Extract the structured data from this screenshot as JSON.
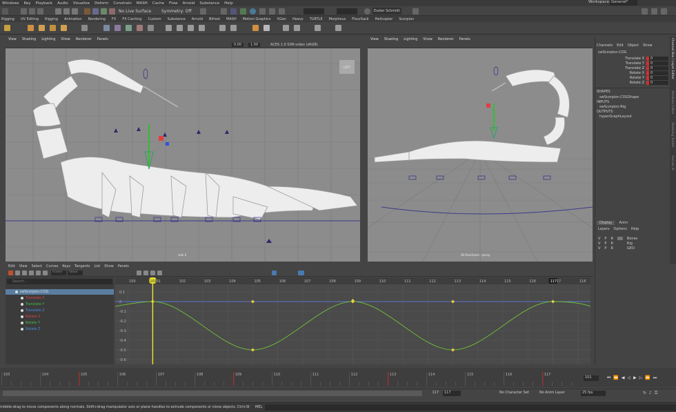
{
  "menu": [
    "Windows",
    "Key",
    "Playback",
    "Audio",
    "Visualize",
    "Deform",
    "Constrain",
    "MASH",
    "Cache",
    "Flow",
    "Arnold",
    "Substance",
    "Help"
  ],
  "toolbar": {
    "live_surface": "No Live Surface",
    "symmetry": "Symmetry: Off",
    "user": "Eszter Schmidt",
    "workspace_label": "Workspace:",
    "workspace": "General*"
  },
  "shelf_tabs": [
    "Rigging",
    "UV Editing",
    "Rigging",
    "Animation",
    "Rendering",
    "FX",
    "FX Caching",
    "Custom",
    "Substance",
    "Arnold",
    "Bifrost",
    "MASH",
    "Motion Graphics",
    "XGen",
    "Heavy",
    "TURTLE",
    "Morpheus",
    "FlourSack",
    "Helicopter",
    "Scorpion"
  ],
  "viewport_menu": [
    "View",
    "Shading",
    "Lighting",
    "Show",
    "Renderer",
    "Panels"
  ],
  "viewport_left": {
    "value_a": "0.00",
    "value_b": "1.00",
    "colorspace": "ACES 1.0 SDR-video (sRGB)",
    "camera_tag": "LEFT",
    "label": "side X"
  },
  "viewport_right": {
    "label": "2D Pan/Zoom : persp"
  },
  "channel_box": {
    "tabs": [
      "Channels",
      "Edit",
      "Object",
      "Show"
    ],
    "object": "swScorpion:COG",
    "attrs": [
      {
        "name": "Translate X",
        "value": "0"
      },
      {
        "name": "Translate Y",
        "value": "0"
      },
      {
        "name": "Translate Z",
        "value": "0"
      },
      {
        "name": "Rotate X",
        "value": "0"
      },
      {
        "name": "Rotate Y",
        "value": "0"
      },
      {
        "name": "Rotate Z",
        "value": "0"
      }
    ],
    "shapes_header": "SHAPES",
    "shape": "swScorpion:COGShape",
    "inputs_header": "INPUTS",
    "input": "swScorpion:Rig",
    "outputs_header": "OUTPUTS",
    "output": "hyperGraphLayout"
  },
  "side_tabs": [
    "Channel Box / Layer Editor",
    "Attribute Editor",
    "Modeling Toolkit",
    "Human IK"
  ],
  "layer_editor": {
    "tabs": [
      "Display",
      "Anim"
    ],
    "menu": [
      "Layers",
      "Options",
      "Help"
    ],
    "layers": [
      {
        "v": "V",
        "p": "P",
        "r": "R",
        "name": "Bones"
      },
      {
        "v": "V",
        "p": "P",
        "r": "R",
        "name": "Rig"
      },
      {
        "v": "V",
        "p": "P",
        "r": "R",
        "name": "GEO"
      }
    ]
  },
  "graph_editor": {
    "menu": [
      "Edit",
      "View",
      "Select",
      "Curves",
      "Keys",
      "Tangents",
      "List",
      "Show",
      "Panels"
    ],
    "stats_a": "Frame",
    "stats_b": "Value",
    "search_placeholder": "Search...",
    "outliner": [
      {
        "name": "swScorpion:COG",
        "color": "#dddddd"
      },
      {
        "name": "Translate X",
        "color": "#e04040"
      },
      {
        "name": "Translate Y",
        "color": "#40c040"
      },
      {
        "name": "Translate Z",
        "color": "#4a8ae0"
      },
      {
        "name": "Rotate X",
        "color": "#e04040"
      },
      {
        "name": "Rotate Y",
        "color": "#40c040"
      },
      {
        "name": "Rotate Z",
        "color": "#4a8ae0"
      }
    ],
    "frame_ticks": [
      "100",
      "101",
      "102",
      "103",
      "104",
      "105",
      "106",
      "107",
      "108",
      "109",
      "110",
      "111",
      "112",
      "113",
      "114",
      "115",
      "116",
      "117",
      "118"
    ],
    "current_frame": "101",
    "end_frame": "117",
    "value_ticks": [
      "0.1",
      "0",
      "-0.1",
      "-0.2",
      "-0.3",
      "-0.4",
      "-0.5",
      "-0.6"
    ]
  },
  "timeline": {
    "ticks": [
      "103",
      "104",
      "105",
      "106",
      "107",
      "108",
      "109",
      "110",
      "111",
      "112",
      "113",
      "114",
      "115",
      "116",
      "117"
    ],
    "current": "101"
  },
  "range": {
    "start": "117",
    "end": "117",
    "char_set": "No Character Set",
    "anim_layer": "No Anim Layer",
    "fps": "25 fps"
  },
  "status": {
    "help": "middle-drag to move components along normals. Shift+drag manipulator axis or plane handles to extrude components or clone objects. Ctrl+Shift+drag to constrain move",
    "mel": "MEL"
  },
  "colors": {
    "curve": "#6fbf3a",
    "key": "#e8d040",
    "flat": "#5a78d0",
    "timemarker": "#e8e030"
  }
}
